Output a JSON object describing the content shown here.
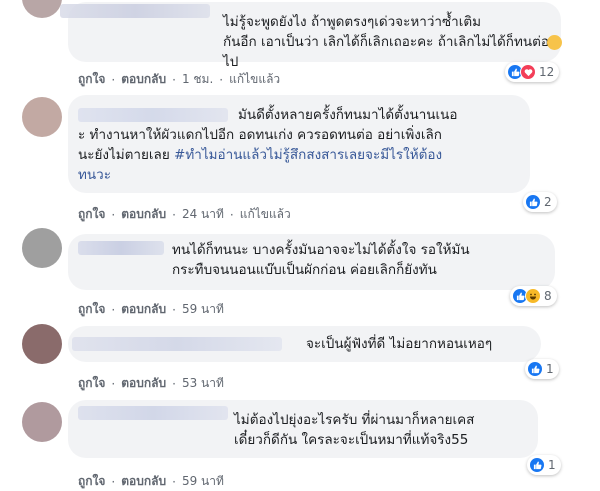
{
  "comments": [
    {
      "text": "ไม่รู้จะพูดยังไง ถ้าพูดตรงๆเด่วจะหาว่าซ้ำเติม\nกันอีก เอาเป็นว่า เลิกได้ก็เลิกเถอะคะ ถ้าเลิกไม่ได้ก็ทนต่อไป",
      "actions": [
        "ถูกใจ",
        "ตอบกลับ",
        "1 ชม.",
        "แก้ไขแล้ว"
      ],
      "reaction_count": "12",
      "reactions": [
        "like",
        "love"
      ],
      "emoji": "smirk-emoji"
    },
    {
      "text_plain": "มันดีตั้งหลายครั้งก็ทนมาได้ตั้งนานเนอ\nะ ทำงานหาให้ผัวแดกไปอีก อดทนเก่ง ควรอดทนต่อ อย่าเพิ่งเลิก\nนะยังไม่ตายเลย ",
      "hashtag": "#ทำไมอ่านแล้วไม่รู้สึกสงสารเลยจะมีไรให้ต้อง\nทนวะ",
      "actions": [
        "ถูกใจ",
        "ตอบกลับ",
        "24 นาที",
        "แก้ไขแล้ว"
      ],
      "reaction_count": "2",
      "reactions": [
        "like"
      ]
    },
    {
      "text": "ทนได้ก็ทนนะ บางครั้งมันอาจจะไม่ได้ตั้งใจ รอให้มัน\nกระทืบจนนอนแบ๊บเป็นผักก่อน ค่อยเลิกก็ยังทัน",
      "actions": [
        "ถูกใจ",
        "ตอบกลับ",
        "59 นาที"
      ],
      "reaction_count": "8",
      "reactions": [
        "like",
        "haha"
      ]
    },
    {
      "text": "จะเป็นผู้ฟังที่ดี ไม่อยากหอนเหอๆ",
      "actions": [
        "ถูกใจ",
        "ตอบกลับ",
        "53 นาที"
      ],
      "reaction_count": "1",
      "reactions": [
        "like"
      ]
    },
    {
      "text": "ไม่ต้องไปยุ่งอะไรครับ ที่ผ่านมาก็หลายเคส\nเดี๋ยวก็ดีกัน ใครละจะเป็นหมาที่แท้จริง55",
      "actions": [
        "ถูกใจ",
        "ตอบกลับ",
        "59 นาที"
      ],
      "reaction_count": "1",
      "reactions": [
        "like"
      ]
    }
  ],
  "colors": {
    "bubble": "#f2f3f5",
    "like": "#1877f2",
    "love": "#f33e58",
    "haha": "#f7b928",
    "hashtag": "#385898"
  }
}
